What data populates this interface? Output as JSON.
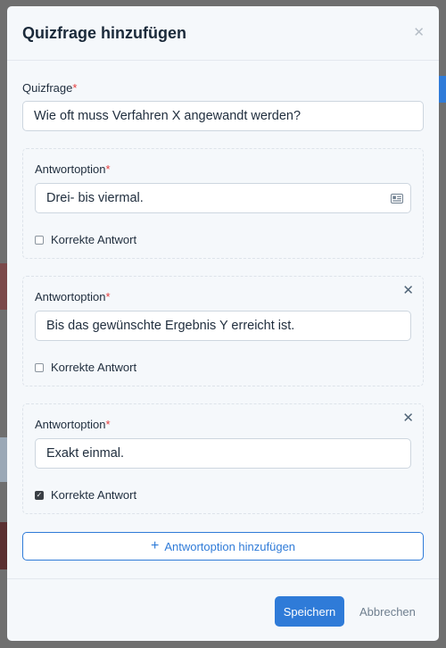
{
  "modal": {
    "title": "Quizfrage hinzufügen",
    "close_icon": "close-icon"
  },
  "question": {
    "label": "Quizfrage",
    "required_mark": "*",
    "value": "Wie oft muss Verfahren X angewandt werden?"
  },
  "answers": [
    {
      "label": "Antwortoption",
      "required_mark": "*",
      "value": "Drei- bis viermal.",
      "correct_label": "Korrekte Antwort",
      "correct": false,
      "removable": false,
      "input_icon": "id-card-icon"
    },
    {
      "label": "Antwortoption",
      "required_mark": "*",
      "value": "Bis das gewünschte Ergebnis Y erreicht ist.",
      "correct_label": "Korrekte Antwort",
      "correct": false,
      "removable": true
    },
    {
      "label": "Antwortoption",
      "required_mark": "*",
      "value": "Exakt einmal.",
      "correct_label": "Korrekte Antwort",
      "correct": true,
      "removable": true
    }
  ],
  "add_answer": {
    "icon": "plus-icon",
    "label": "Antwortoption hinzufügen"
  },
  "footer": {
    "save_label": "Speichern",
    "cancel_label": "Abbrechen"
  },
  "colors": {
    "accent": "#2f7bd8",
    "required": "#e53e3e",
    "modal_bg": "#f5f8fb"
  }
}
